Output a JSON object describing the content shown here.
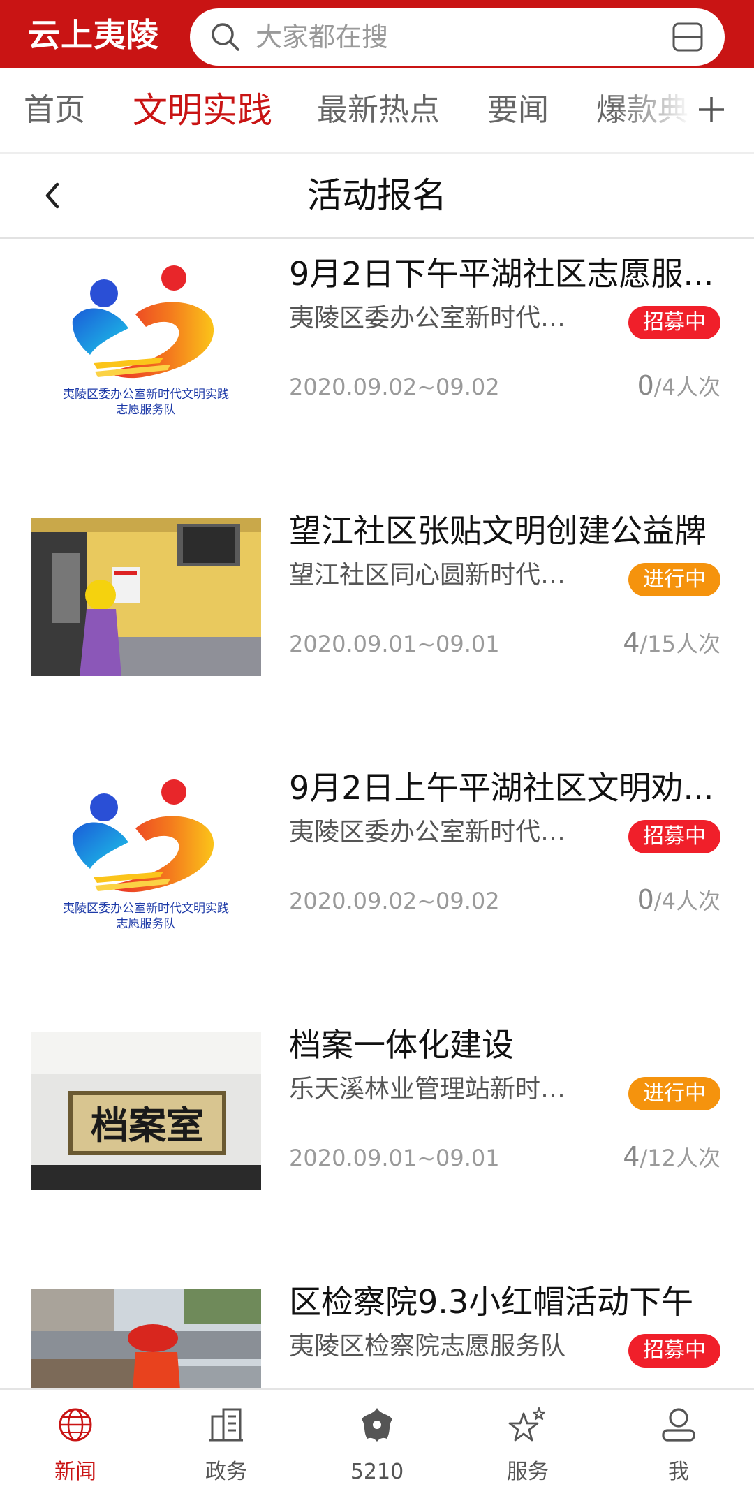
{
  "header": {
    "logo": "云上夷陵",
    "search_placeholder": "大家都在搜"
  },
  "tabs": [
    {
      "label": "首页",
      "active": false
    },
    {
      "label": "文明实践",
      "active": true
    },
    {
      "label": "最新热点",
      "active": false
    },
    {
      "label": "要闻",
      "active": false
    },
    {
      "label": "爆款典",
      "active": false
    }
  ],
  "page": {
    "title": "活动报名"
  },
  "items": [
    {
      "title": "9月2日下午平湖社区志愿服...",
      "org": "夷陵区委办公室新时代文...",
      "status": "招募中",
      "date": "2020.09.02~09.02",
      "joined": "0",
      "total": "/4人次",
      "thumb": "logo",
      "logo_caption_1": "夷陵区委办公室新时代文明实践",
      "logo_caption_2": "志愿服务队"
    },
    {
      "title": "望江社区张贴文明创建公益牌",
      "org": "望江社区同心圆新时代文...",
      "status": "进行中",
      "date": "2020.09.01~09.01",
      "joined": "4",
      "total": "/15人次",
      "thumb": "photo-wall"
    },
    {
      "title": "9月2日上午平湖社区文明劝...",
      "org": "夷陵区委办公室新时代文...",
      "status": "招募中",
      "date": "2020.09.02~09.02",
      "joined": "0",
      "total": "/4人次",
      "thumb": "logo",
      "logo_caption_1": "夷陵区委办公室新时代文明实践",
      "logo_caption_2": "志愿服务队"
    },
    {
      "title": "档案一体化建设",
      "org": "乐天溪林业管理站新时代...",
      "status": "进行中",
      "date": "2020.09.01~09.01",
      "joined": "4",
      "total": "/12人次",
      "thumb": "photo-sign",
      "sign_text": "档案室"
    },
    {
      "title": "区检察院9.3小红帽活动下午",
      "org": "夷陵区检察院志愿服务队",
      "status": "招募中",
      "thumb": "photo-street"
    }
  ],
  "colors": {
    "brand": "#c91414",
    "recruit": "#f01f2a",
    "ongoing": "#f5930d"
  },
  "bottom_nav": [
    {
      "label": "新闻",
      "icon": "globe-icon",
      "active": true
    },
    {
      "label": "政务",
      "icon": "building-icon",
      "active": false
    },
    {
      "label": "5210",
      "icon": "flower-icon",
      "active": false
    },
    {
      "label": "服务",
      "icon": "stars-icon",
      "active": false
    },
    {
      "label": "我",
      "icon": "user-icon",
      "active": false
    }
  ]
}
